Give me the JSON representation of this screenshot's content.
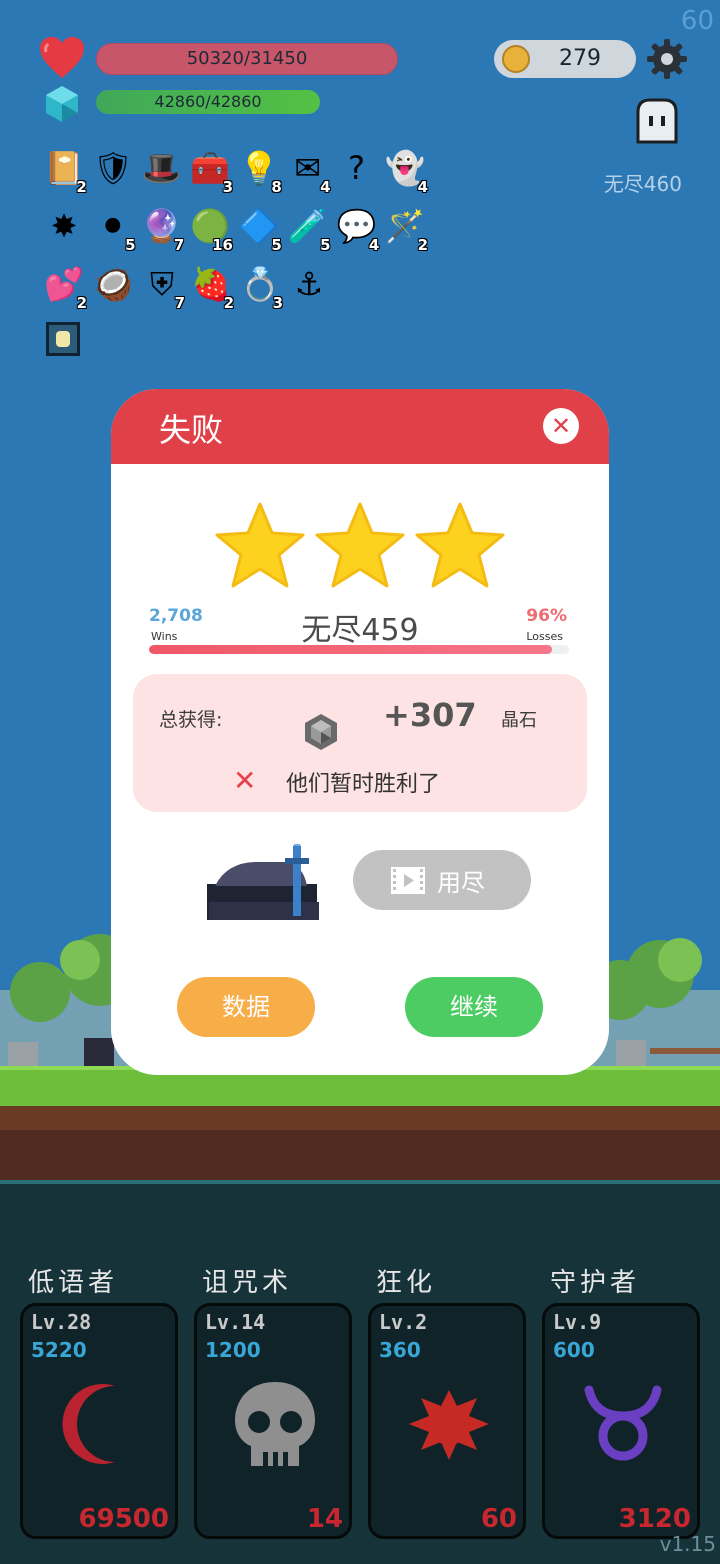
{
  "fps": "60",
  "version": "v1.15",
  "hud": {
    "hp_text": "50320/31450",
    "mp_text": "42860/42860",
    "coins": "279",
    "endless_label": "无尽460"
  },
  "inventory": [
    [
      {
        "icon": "book-icon",
        "glyph": "📔",
        "count": "2"
      },
      {
        "icon": "shield-icon",
        "glyph": "🛡",
        "count": ""
      },
      {
        "icon": "wizard-hat-icon",
        "glyph": "🎩",
        "count": ""
      },
      {
        "icon": "treasure-box-icon",
        "glyph": "🧰",
        "count": "3"
      },
      {
        "icon": "lightbulb-icon",
        "glyph": "💡",
        "count": "8"
      },
      {
        "icon": "envelope-icon",
        "glyph": "✉",
        "count": "4"
      },
      {
        "icon": "question-icon",
        "glyph": "?",
        "count": ""
      },
      {
        "icon": "ghost-icon",
        "glyph": "👻",
        "count": "4"
      }
    ],
    [
      {
        "icon": "spiked-ball-icon",
        "glyph": "✸",
        "count": ""
      },
      {
        "icon": "cauldron-icon",
        "glyph": "⚫",
        "count": "5"
      },
      {
        "icon": "crystal-ball-icon",
        "glyph": "🔮",
        "count": "7"
      },
      {
        "icon": "slime-icon",
        "glyph": "🟢",
        "count": "16"
      },
      {
        "icon": "blue-gem-icon",
        "glyph": "🔷",
        "count": "5"
      },
      {
        "icon": "potion-icon",
        "glyph": "🧪",
        "count": "5"
      },
      {
        "icon": "speech-bubble-icon",
        "glyph": "💬",
        "count": "4"
      },
      {
        "icon": "magic-wand-icon",
        "glyph": "🪄",
        "count": "2"
      }
    ],
    [
      {
        "icon": "hearts-icon",
        "glyph": "💕",
        "count": "2"
      },
      {
        "icon": "coconut-icon",
        "glyph": "🥥",
        "count": ""
      },
      {
        "icon": "red-shield-icon",
        "glyph": "⛨",
        "count": "7"
      },
      {
        "icon": "strawberry-icon",
        "glyph": "🍓",
        "count": "2"
      },
      {
        "icon": "ring-icon",
        "glyph": "💍",
        "count": "3"
      },
      {
        "icon": "hook-icon",
        "glyph": "⚓",
        "count": ""
      }
    ]
  ],
  "skills": [
    {
      "name": "低语者",
      "lv": "Lv.28",
      "cost": "5220",
      "value": "69500",
      "icon": "crescent-moon-icon",
      "color": "#b8232f"
    },
    {
      "name": "诅咒术",
      "lv": "Lv.14",
      "cost": "1200",
      "value": "14",
      "icon": "skull-icon",
      "color": "#8f8f8f"
    },
    {
      "name": "狂化",
      "lv": "Lv.2",
      "cost": "360",
      "value": "60",
      "icon": "splatter-icon",
      "color": "#c52a24"
    },
    {
      "name": "守护者",
      "lv": "Lv.9",
      "cost": "600",
      "value": "3120",
      "icon": "taurus-icon",
      "color": "#6a3fc2"
    }
  ],
  "dialog": {
    "title": "失败",
    "stars": 3,
    "stage_name": "无尽459",
    "wins_value": "2,708",
    "wins_label": "Wins",
    "losses_value": "96%",
    "losses_label": "Losses",
    "loss_progress": 0.96,
    "reward_label": "总获得:",
    "reward_value": "+307",
    "reward_unit": "晶石",
    "result_message": "他们暂时胜利了",
    "video_button": "用尽",
    "data_button": "数据",
    "continue_button": "继续"
  },
  "colors": {
    "dialog_header": "#e04149",
    "data_button": "#f8ae48",
    "continue_button": "#4ccc62",
    "video_button": "#c2c2c2"
  }
}
